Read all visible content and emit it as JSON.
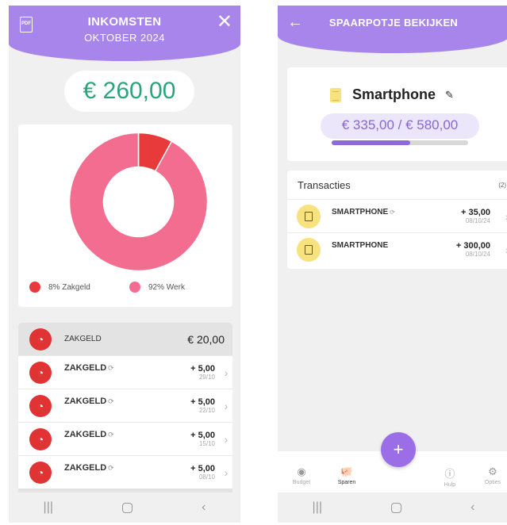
{
  "left": {
    "header": {
      "title": "INKOMSTEN",
      "subtitle": "OKTOBER 2024",
      "pdf_icon_label": "PDF"
    },
    "total": "€ 260,00",
    "chart_data": {
      "type": "pie",
      "donut": true,
      "slices": [
        {
          "label": "Zakgeld",
          "percent": 8,
          "color": "#e83a3a"
        },
        {
          "label": "Werk",
          "percent": 92,
          "color": "#f26d8f"
        }
      ]
    },
    "legend": [
      {
        "text": "8% Zakgeld",
        "color": "#e83a3a"
      },
      {
        "text": "92% Werk",
        "color": "#f26d8f"
      }
    ],
    "group": {
      "label": "ZAKGELD",
      "amount": "€ 20,00"
    },
    "transactions": [
      {
        "name": "ZAKGELD",
        "amount": "+ 5,00",
        "date": "29/10"
      },
      {
        "name": "ZAKGELD",
        "amount": "+ 5,00",
        "date": "22/10"
      },
      {
        "name": "ZAKGELD",
        "amount": "+ 5,00",
        "date": "15/10"
      },
      {
        "name": "ZAKGELD",
        "amount": "+ 5,00",
        "date": "08/10"
      }
    ]
  },
  "right": {
    "header": {
      "title": "SPAARPOTJE BEKIJKEN"
    },
    "goal": {
      "name": "Smartphone",
      "progress_text": "€ 335,00 / € 580,00",
      "saved": 335,
      "target": 580
    },
    "transactions_title": "Transacties",
    "transactions_count": "(2)",
    "transactions": [
      {
        "name": "SMARTPHONE",
        "amount": "+ 35,00",
        "date": "08/10/24"
      },
      {
        "name": "SMARTPHONE",
        "amount": "+ 300,00",
        "date": "08/10/24"
      }
    ],
    "tabs": [
      {
        "label": "Budget",
        "icon": "eye-icon"
      },
      {
        "label": "Sparen",
        "icon": "piggy-bank-icon"
      },
      {
        "label": "Hulp",
        "icon": "help-icon"
      },
      {
        "label": "Opties",
        "icon": "gear-icon"
      }
    ],
    "fab_label": "+"
  },
  "colors": {
    "accent": "#a885ea",
    "income_green": "#2aa57b",
    "zakgeld_red": "#e83a3a",
    "werk_pink": "#f26d8f",
    "goal_yellow": "#f7e27d"
  }
}
